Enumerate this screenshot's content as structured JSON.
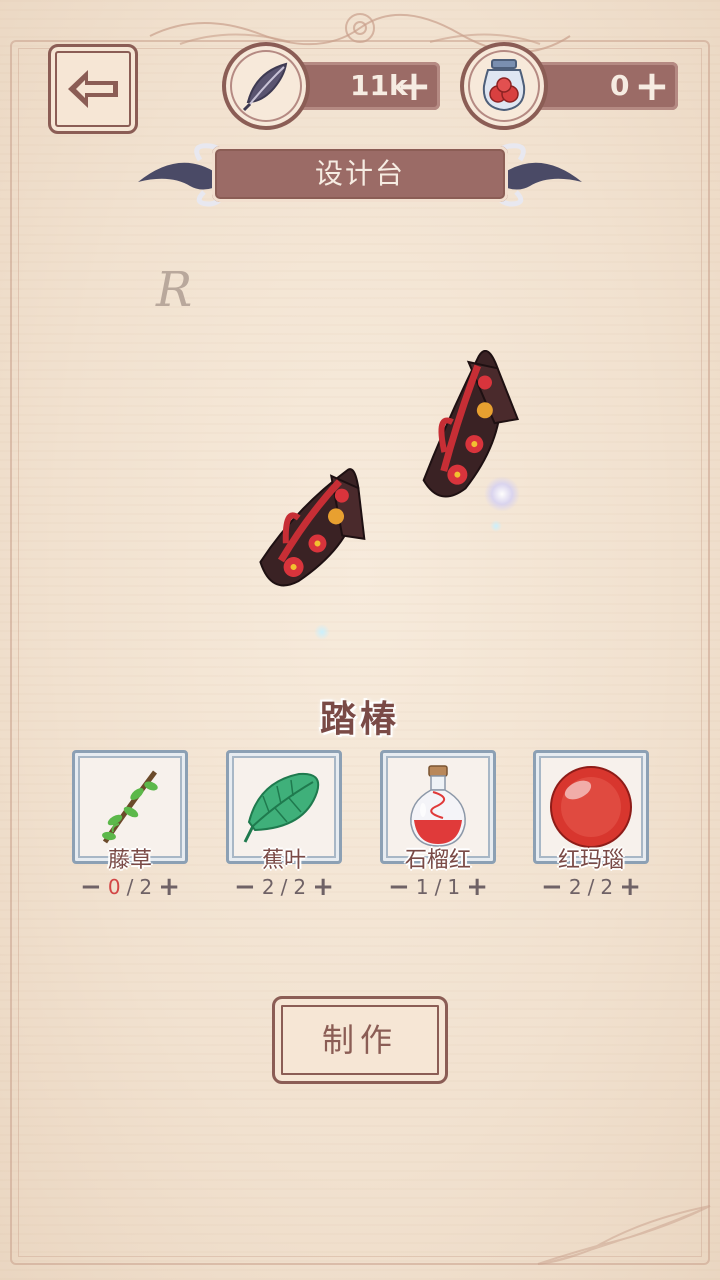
{
  "header": {
    "back_icon": "back-arrow-icon",
    "feather": {
      "icon": "feather-quill-icon",
      "value": "11k",
      "plus_icon": "plus-icon"
    },
    "potion": {
      "icon": "berry-jar-icon",
      "value": "0",
      "plus_icon": "plus-icon"
    }
  },
  "banner": {
    "title": "设计台"
  },
  "item": {
    "rarity": "R",
    "name": "踏椿"
  },
  "materials": [
    {
      "name": "藤草",
      "icon": "vine-branch-icon",
      "have": "0",
      "need": "2",
      "short": true
    },
    {
      "name": "蕉叶",
      "icon": "banana-leaf-icon",
      "have": "2",
      "need": "2",
      "short": false
    },
    {
      "name": "石榴红",
      "icon": "red-potion-bottle-icon",
      "have": "1",
      "need": "1",
      "short": false
    },
    {
      "name": "红玛瑙",
      "icon": "red-agate-orb-icon",
      "have": "2",
      "need": "2",
      "short": false
    }
  ],
  "actions": {
    "make_label": "制作"
  },
  "colors": {
    "accent": "#8b5d55",
    "plate": "#9b6b66",
    "background": "#f2e4d3",
    "short_count": "#d24545",
    "slot_border": "#8ca0b4"
  }
}
